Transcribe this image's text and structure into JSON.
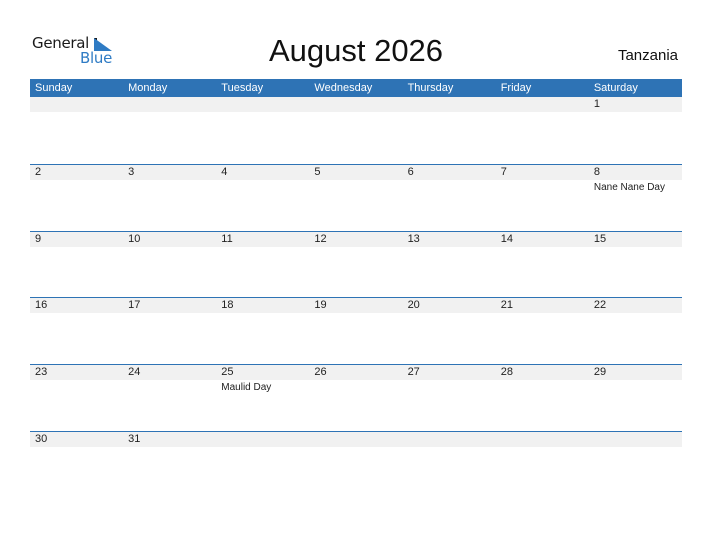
{
  "logo": {
    "general": "General",
    "blue": "Blue"
  },
  "title": "August 2026",
  "country": "Tanzania",
  "colors": {
    "accent": "#2e73b5",
    "date_strip": "#f1f1f1",
    "logo_blue": "#2e7bc4"
  },
  "weekdays": [
    "Sunday",
    "Monday",
    "Tuesday",
    "Wednesday",
    "Thursday",
    "Friday",
    "Saturday"
  ],
  "weeks": [
    [
      {
        "d": ""
      },
      {
        "d": ""
      },
      {
        "d": ""
      },
      {
        "d": ""
      },
      {
        "d": ""
      },
      {
        "d": ""
      },
      {
        "d": "1"
      }
    ],
    [
      {
        "d": "2"
      },
      {
        "d": "3"
      },
      {
        "d": "4"
      },
      {
        "d": "5"
      },
      {
        "d": "6"
      },
      {
        "d": "7"
      },
      {
        "d": "8",
        "event": "Nane Nane Day"
      }
    ],
    [
      {
        "d": "9"
      },
      {
        "d": "10"
      },
      {
        "d": "11"
      },
      {
        "d": "12"
      },
      {
        "d": "13"
      },
      {
        "d": "14"
      },
      {
        "d": "15"
      }
    ],
    [
      {
        "d": "16"
      },
      {
        "d": "17"
      },
      {
        "d": "18"
      },
      {
        "d": "19"
      },
      {
        "d": "20"
      },
      {
        "d": "21"
      },
      {
        "d": "22"
      }
    ],
    [
      {
        "d": "23"
      },
      {
        "d": "24"
      },
      {
        "d": "25",
        "event": "Maulid Day"
      },
      {
        "d": "26"
      },
      {
        "d": "27"
      },
      {
        "d": "28"
      },
      {
        "d": "29"
      }
    ],
    [
      {
        "d": "30"
      },
      {
        "d": "31"
      },
      {
        "d": ""
      },
      {
        "d": ""
      },
      {
        "d": ""
      },
      {
        "d": ""
      },
      {
        "d": ""
      }
    ]
  ]
}
